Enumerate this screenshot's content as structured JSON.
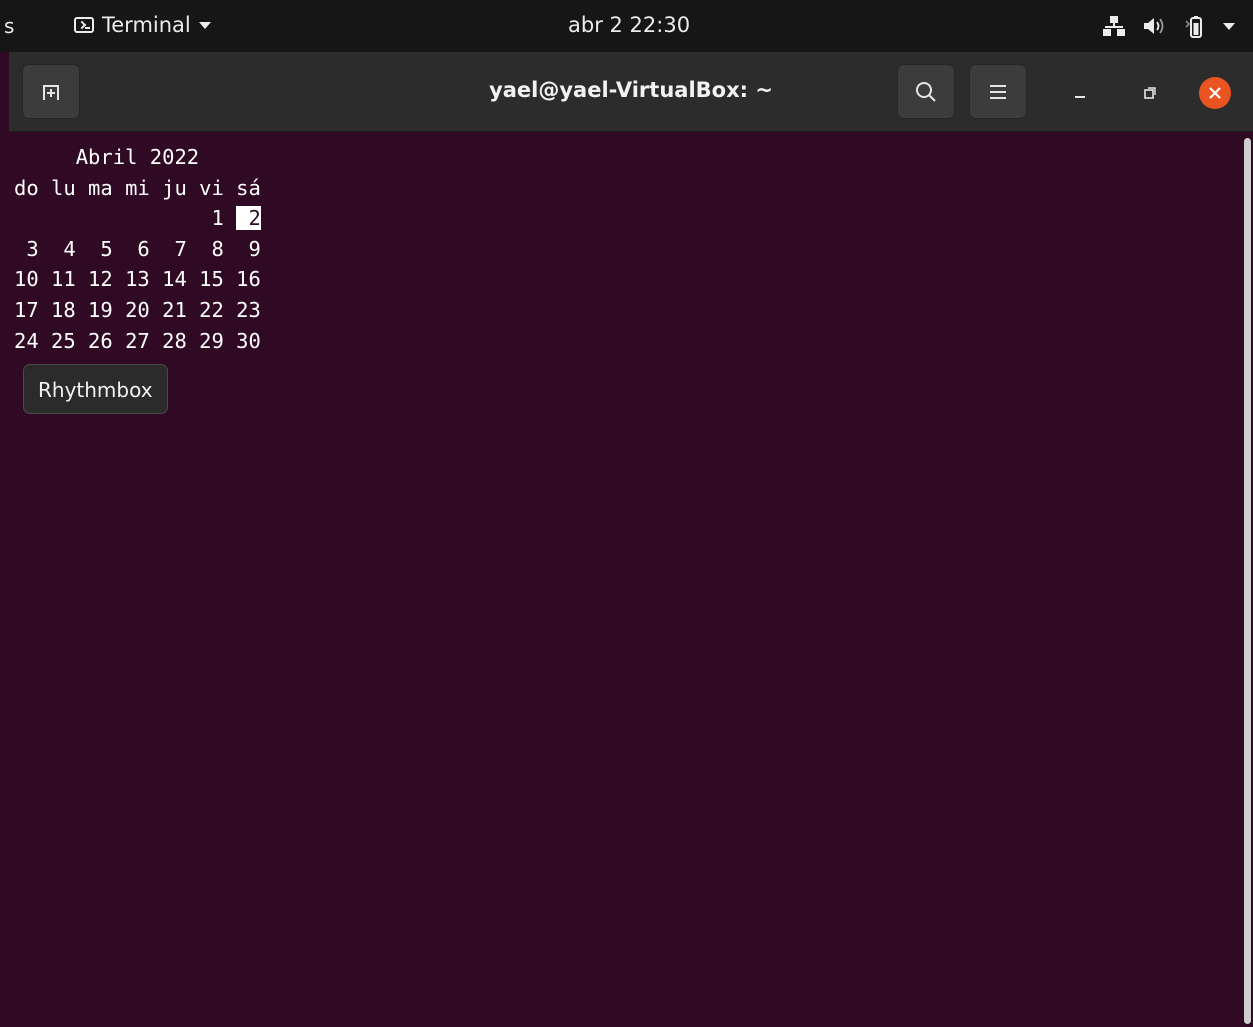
{
  "topbar": {
    "activities_fragment": "s",
    "app_menu_label": "Terminal",
    "clock": "abr 2  22:30",
    "tray_icons": [
      "network-icon",
      "volume-icon",
      "battery-icon",
      "system-menu-arrow-icon"
    ]
  },
  "window": {
    "title": "yael@yael-VirtualBox: ~",
    "buttons": [
      "new-tab-icon",
      "search-icon",
      "hamburger-menu-icon",
      "minimize-icon",
      "maximize-icon",
      "close-icon"
    ]
  },
  "terminal": {
    "calendar": {
      "header": "     Abril 2022",
      "weekdays": "do lu ma mi ju vi sá",
      "first_week_prefix": "                1 ",
      "today": " 2",
      "weeks": [
        " 3  4  5  6  7  8  9",
        "10 11 12 13 14 15 16",
        "17 18 19 20 21 22 23",
        "24 25 26 27 28 29 30"
      ]
    },
    "tooltip": "Rhythmbox"
  }
}
